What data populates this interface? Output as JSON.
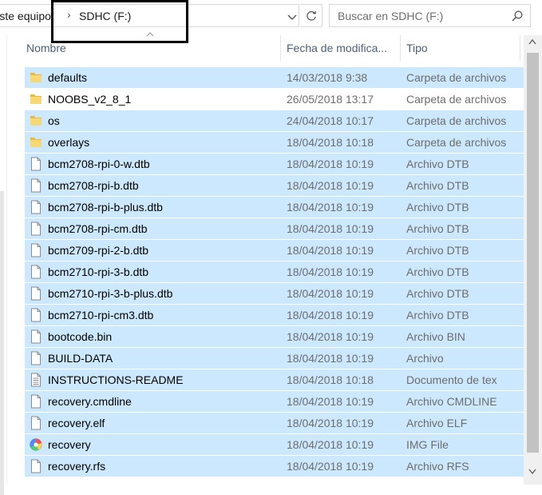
{
  "address_bar": {
    "crumbs": [
      "Este equipo",
      "SDHC (F:)"
    ]
  },
  "search": {
    "placeholder": "Buscar en SDHC (F:)"
  },
  "columns": {
    "name": "Nombre",
    "date": "Fecha de modifica...",
    "type": "Tipo"
  },
  "files": [
    {
      "name": "defaults",
      "date": "14/03/2018 9:38",
      "type": "Carpeta de archivos",
      "icon": "folder-icon",
      "selected": true
    },
    {
      "name": "NOOBS_v2_8_1",
      "date": "26/05/2018 13:17",
      "type": "Carpeta de archivos",
      "icon": "folder-icon",
      "selected": false
    },
    {
      "name": "os",
      "date": "24/04/2018 10:17",
      "type": "Carpeta de archivos",
      "icon": "folder-icon",
      "selected": true
    },
    {
      "name": "overlays",
      "date": "18/04/2018 10:18",
      "type": "Carpeta de archivos",
      "icon": "folder-icon",
      "selected": true
    },
    {
      "name": "bcm2708-rpi-0-w.dtb",
      "date": "18/04/2018 10:19",
      "type": "Archivo DTB",
      "icon": "file-icon",
      "selected": true
    },
    {
      "name": "bcm2708-rpi-b.dtb",
      "date": "18/04/2018 10:19",
      "type": "Archivo DTB",
      "icon": "file-icon",
      "selected": true
    },
    {
      "name": "bcm2708-rpi-b-plus.dtb",
      "date": "18/04/2018 10:19",
      "type": "Archivo DTB",
      "icon": "file-icon",
      "selected": true
    },
    {
      "name": "bcm2708-rpi-cm.dtb",
      "date": "18/04/2018 10:19",
      "type": "Archivo DTB",
      "icon": "file-icon",
      "selected": true
    },
    {
      "name": "bcm2709-rpi-2-b.dtb",
      "date": "18/04/2018 10:19",
      "type": "Archivo DTB",
      "icon": "file-icon",
      "selected": true
    },
    {
      "name": "bcm2710-rpi-3-b.dtb",
      "date": "18/04/2018 10:19",
      "type": "Archivo DTB",
      "icon": "file-icon",
      "selected": true
    },
    {
      "name": "bcm2710-rpi-3-b-plus.dtb",
      "date": "18/04/2018 10:19",
      "type": "Archivo DTB",
      "icon": "file-icon",
      "selected": true
    },
    {
      "name": "bcm2710-rpi-cm3.dtb",
      "date": "18/04/2018 10:19",
      "type": "Archivo DTB",
      "icon": "file-icon",
      "selected": true
    },
    {
      "name": "bootcode.bin",
      "date": "18/04/2018 10:19",
      "type": "Archivo BIN",
      "icon": "file-icon",
      "selected": true
    },
    {
      "name": "BUILD-DATA",
      "date": "18/04/2018 10:19",
      "type": "Archivo",
      "icon": "file-icon",
      "selected": true
    },
    {
      "name": "INSTRUCTIONS-README",
      "date": "18/04/2018 10:18",
      "type": "Documento de tex",
      "icon": "text-document-icon",
      "selected": true
    },
    {
      "name": "recovery.cmdline",
      "date": "18/04/2018 10:19",
      "type": "Archivo CMDLINE",
      "icon": "file-icon",
      "selected": true
    },
    {
      "name": "recovery.elf",
      "date": "18/04/2018 10:19",
      "type": "Archivo ELF",
      "icon": "file-icon",
      "selected": true
    },
    {
      "name": "recovery",
      "date": "18/04/2018 10:19",
      "type": "IMG File",
      "icon": "disc-image-icon",
      "selected": true
    },
    {
      "name": "recovery.rfs",
      "date": "18/04/2018 10:19",
      "type": "Archivo RFS",
      "icon": "file-icon",
      "selected": true
    }
  ],
  "colors": {
    "selection": "#cce8ff",
    "folder": "#f8d775",
    "header_text": "#4c607a"
  }
}
